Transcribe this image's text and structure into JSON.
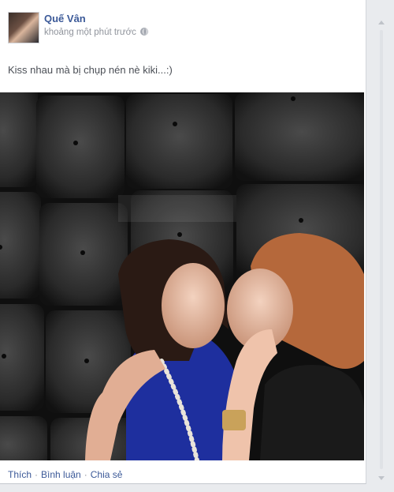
{
  "post": {
    "author": "Quế Vân",
    "timestamp": "khoảng một phút trước",
    "privacy_icon": "globe-icon",
    "text": "Kiss nhau mà bị chụp nén nè kiki...:)",
    "actions": {
      "like": "Thích",
      "comment": "Bình luận",
      "share": "Chia sẻ",
      "separator": "·"
    }
  },
  "colors": {
    "link": "#3b5998",
    "meta": "#90949c",
    "page_bg": "#e9ebee"
  }
}
